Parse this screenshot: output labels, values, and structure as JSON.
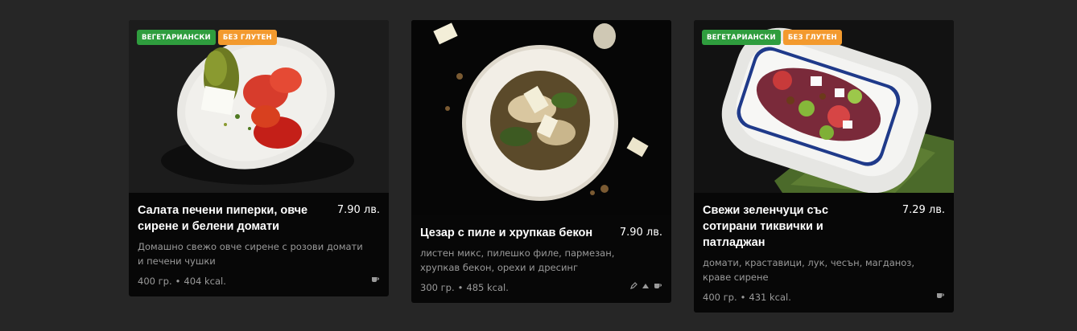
{
  "cards": [
    {
      "badges": [
        "ВЕГЕТАРИАНСКИ",
        "БЕЗ ГЛУТЕН"
      ],
      "title": "Салата печени пиперки, овче сирене и белени домати",
      "price": "7.90 лв.",
      "description": "Домашно свежо овче сирене с розови домати и печени чушки",
      "weight": "400 гр.",
      "separator": "•",
      "kcal": "404 kcal.",
      "icons": [
        "cup-icon"
      ]
    },
    {
      "badges": [],
      "title": "Цезар с пиле и хрупкав бекон",
      "price": "7.90 лв.",
      "description": "листен микс, пилешко филе, пармезан, хрупкав бекон, орехи и дресинг",
      "weight": "300 гр.",
      "separator": "•",
      "kcal": "485 kcal.",
      "icons": [
        "pencil-icon",
        "cheese-icon",
        "cup-icon"
      ]
    },
    {
      "badges": [
        "ВЕГЕТАРИАНСКИ",
        "БЕЗ ГЛУТЕН"
      ],
      "title": "Свежи зеленчуци със сотирани тиквички и патладжан",
      "price": "7.29 лв.",
      "description": "домати, краставици, лук, чесън, магданоз, краве сирене",
      "weight": "400 гр.",
      "separator": "•",
      "kcal": "431 kcal.",
      "icons": [
        "cup-icon"
      ]
    }
  ],
  "colors": {
    "page_bg": "#262626",
    "card_bg": "#070707",
    "veg_badge": "#2f9d3e",
    "gf_badge": "#f39a2e",
    "muted_text": "#9a9a9a"
  }
}
